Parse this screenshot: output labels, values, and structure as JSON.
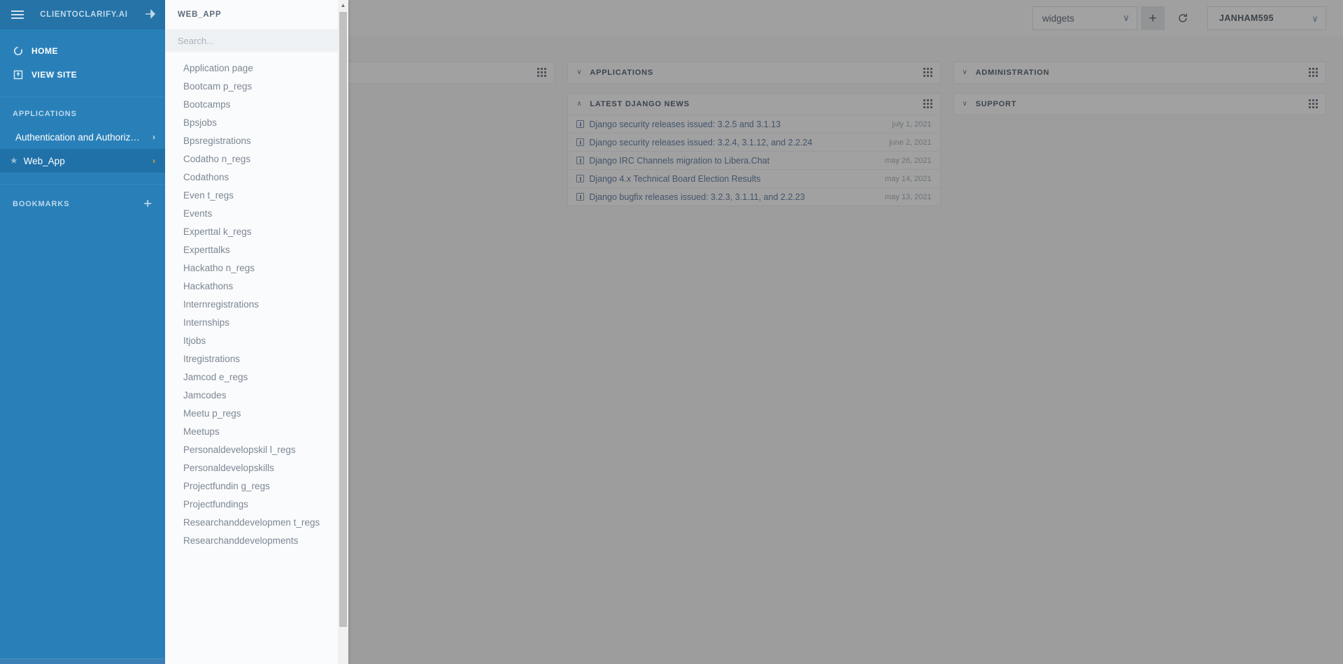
{
  "sidebar": {
    "brand": "CLIENTOCLARIFY.AI",
    "menu_icon": "hamburger-icon",
    "pin_icon": "pin-icon",
    "nav": [
      {
        "label": "HOME",
        "icon": "circle-icon"
      },
      {
        "label": "VIEW SITE",
        "icon": "external-link-icon"
      }
    ],
    "applications_heading": "APPLICATIONS",
    "apps": [
      {
        "label": "Authentication and Authoriz…",
        "active": false,
        "starred": false
      },
      {
        "label": "Web_App",
        "active": true,
        "starred": true
      }
    ],
    "bookmarks_heading": "BOOKMARKS",
    "bookmarks_add_label": "+"
  },
  "flyout": {
    "title": "WEB_APP",
    "search": {
      "value": "",
      "placeholder": "Search..."
    },
    "items": [
      "Application page",
      "Bootcam p_regs",
      "Bootcamps",
      "Bpsjobs",
      "Bpsregistrations",
      "Codatho n_regs",
      "Codathons",
      "Even t_regs",
      "Events",
      "Experttal k_regs",
      "Experttalks",
      "Hackatho n_regs",
      "Hackathons",
      "Internregistrations",
      "Internships",
      "Itjobs",
      "Itregistrations",
      "Jamcod e_regs",
      "Jamcodes",
      "Meetu p_regs",
      "Meetups",
      "Personaldevelopskil l_regs",
      "Personaldevelopskills",
      "Projectfundin g_regs",
      "Projectfundings",
      "Researchanddevelopmen t_regs",
      "Researchanddevelopments"
    ]
  },
  "toolbar": {
    "widget_select": {
      "value": "widgets",
      "caret": "∨"
    },
    "add_label": "+",
    "refresh_icon": "refresh-icon",
    "user_select": {
      "value": "JANHAM595",
      "caret": "∨"
    }
  },
  "dashboard": {
    "panels": {
      "hidden_left": {
        "title": "",
        "caret": "∨"
      },
      "applications": {
        "title": "APPLICATIONS",
        "caret": "∨"
      },
      "administration": {
        "title": "ADMINISTRATION",
        "caret": "∨"
      },
      "support": {
        "title": "SUPPORT",
        "caret": "∨"
      },
      "news": {
        "title": "LATEST DJANGO NEWS",
        "caret": "∧"
      }
    },
    "news_items": [
      {
        "title": "Django security releases issued: 3.2.5 and 3.1.13",
        "date": "july 1, 2021"
      },
      {
        "title": "Django security releases issued: 3.2.4, 3.1.12, and 2.2.24",
        "date": "june 2, 2021"
      },
      {
        "title": "Django IRC Channels migration to Libera.Chat",
        "date": "may 26, 2021"
      },
      {
        "title": "Django 4.x Technical Board Election Results",
        "date": "may 14, 2021"
      },
      {
        "title": "Django bugfix releases issued: 3.2.3, 3.1.11, and 2.2.23",
        "date": "may 13, 2021"
      }
    ]
  },
  "colors": {
    "sidebar_blue": "#2980b9",
    "sidebar_active": "#2071a8",
    "accent_orange": "#f0a32a",
    "link_blue": "#4a6b96"
  }
}
